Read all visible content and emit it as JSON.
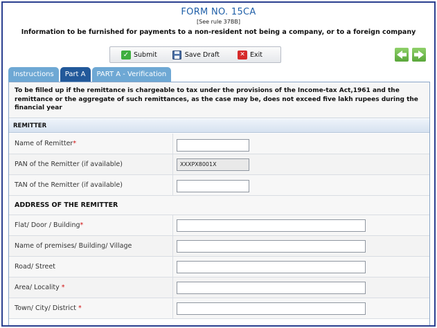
{
  "header": {
    "title": "FORM NO. 15CA",
    "rule": "[See rule 37BB]",
    "subtitle": "Information to be furnished for payments to a non-resident not being a company, or to a foreign company"
  },
  "toolbar": {
    "submit_label": "Submit",
    "save_label": "Save Draft",
    "exit_label": "Exit"
  },
  "tabs": [
    {
      "label": "Instructions",
      "active": false
    },
    {
      "label": "Part A",
      "active": true
    },
    {
      "label": "PART A - Verification",
      "active": false
    }
  ],
  "note": "To be filled up if the remittance is chargeable to tax under the provisions of the Income-tax Act,1961 and the remittance or the aggregate of such remittances, as the case may be, does not exceed five lakh rupees during the financial year",
  "remitter": {
    "section_title": "REMITTER",
    "name_label": "Name of Remitter",
    "name_value": "",
    "pan_label": "PAN of the Remitter (if available)",
    "pan_value": "XXXPX8001X",
    "tan_label": "TAN of the Remitter (if available)",
    "tan_value": ""
  },
  "address": {
    "section_title": "ADDRESS OF THE REMITTER",
    "flat_label": "Flat/ Door / Building",
    "premises_label": "Name of premises/ Building/ Village",
    "road_label": "Road/ Street",
    "area_label": "Area/ Locality ",
    "town_label": "Town/ City/ District "
  },
  "required_marker": "*",
  "colors": {
    "frame": "#2a3f8f",
    "title": "#1f5fa8",
    "tab_active": "#22599a",
    "tab_inactive": "#6ea8d4",
    "required": "#d01010"
  }
}
